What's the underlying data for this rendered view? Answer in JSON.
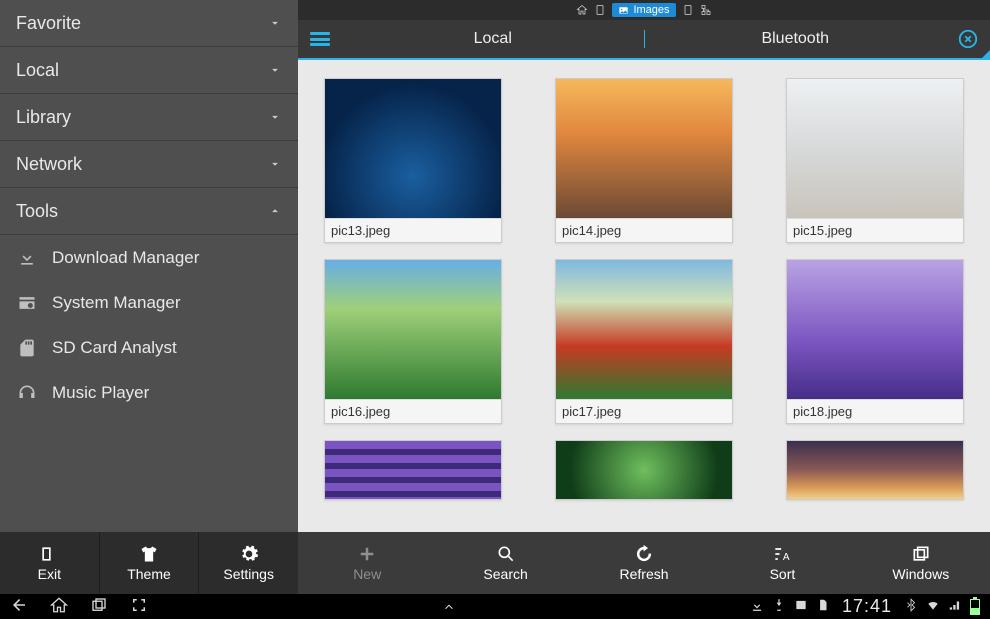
{
  "sidebar": {
    "sections": [
      {
        "label": "Favorite",
        "expanded": false
      },
      {
        "label": "Local",
        "expanded": false
      },
      {
        "label": "Library",
        "expanded": false
      },
      {
        "label": "Network",
        "expanded": false
      },
      {
        "label": "Tools",
        "expanded": true
      }
    ],
    "tools": [
      {
        "label": "Download Manager"
      },
      {
        "label": "System Manager"
      },
      {
        "label": "SD Card Analyst"
      },
      {
        "label": "Music Player"
      }
    ],
    "bottom": [
      {
        "label": "Exit"
      },
      {
        "label": "Theme"
      },
      {
        "label": "Settings"
      }
    ]
  },
  "top_tabs": {
    "active_label": "Images"
  },
  "header": {
    "tabs": [
      {
        "label": "Local"
      },
      {
        "label": "Bluetooth"
      }
    ]
  },
  "grid": {
    "items": [
      {
        "filename": "pic13.jpeg"
      },
      {
        "filename": "pic14.jpeg"
      },
      {
        "filename": "pic15.jpeg"
      },
      {
        "filename": "pic16.jpeg"
      },
      {
        "filename": "pic17.jpeg"
      },
      {
        "filename": "pic18.jpeg"
      }
    ]
  },
  "content_bottom": [
    {
      "label": "New",
      "disabled": true
    },
    {
      "label": "Search",
      "disabled": false
    },
    {
      "label": "Refresh",
      "disabled": false
    },
    {
      "label": "Sort",
      "disabled": false
    },
    {
      "label": "Windows",
      "disabled": false
    }
  ],
  "status": {
    "clock": "17:41"
  }
}
